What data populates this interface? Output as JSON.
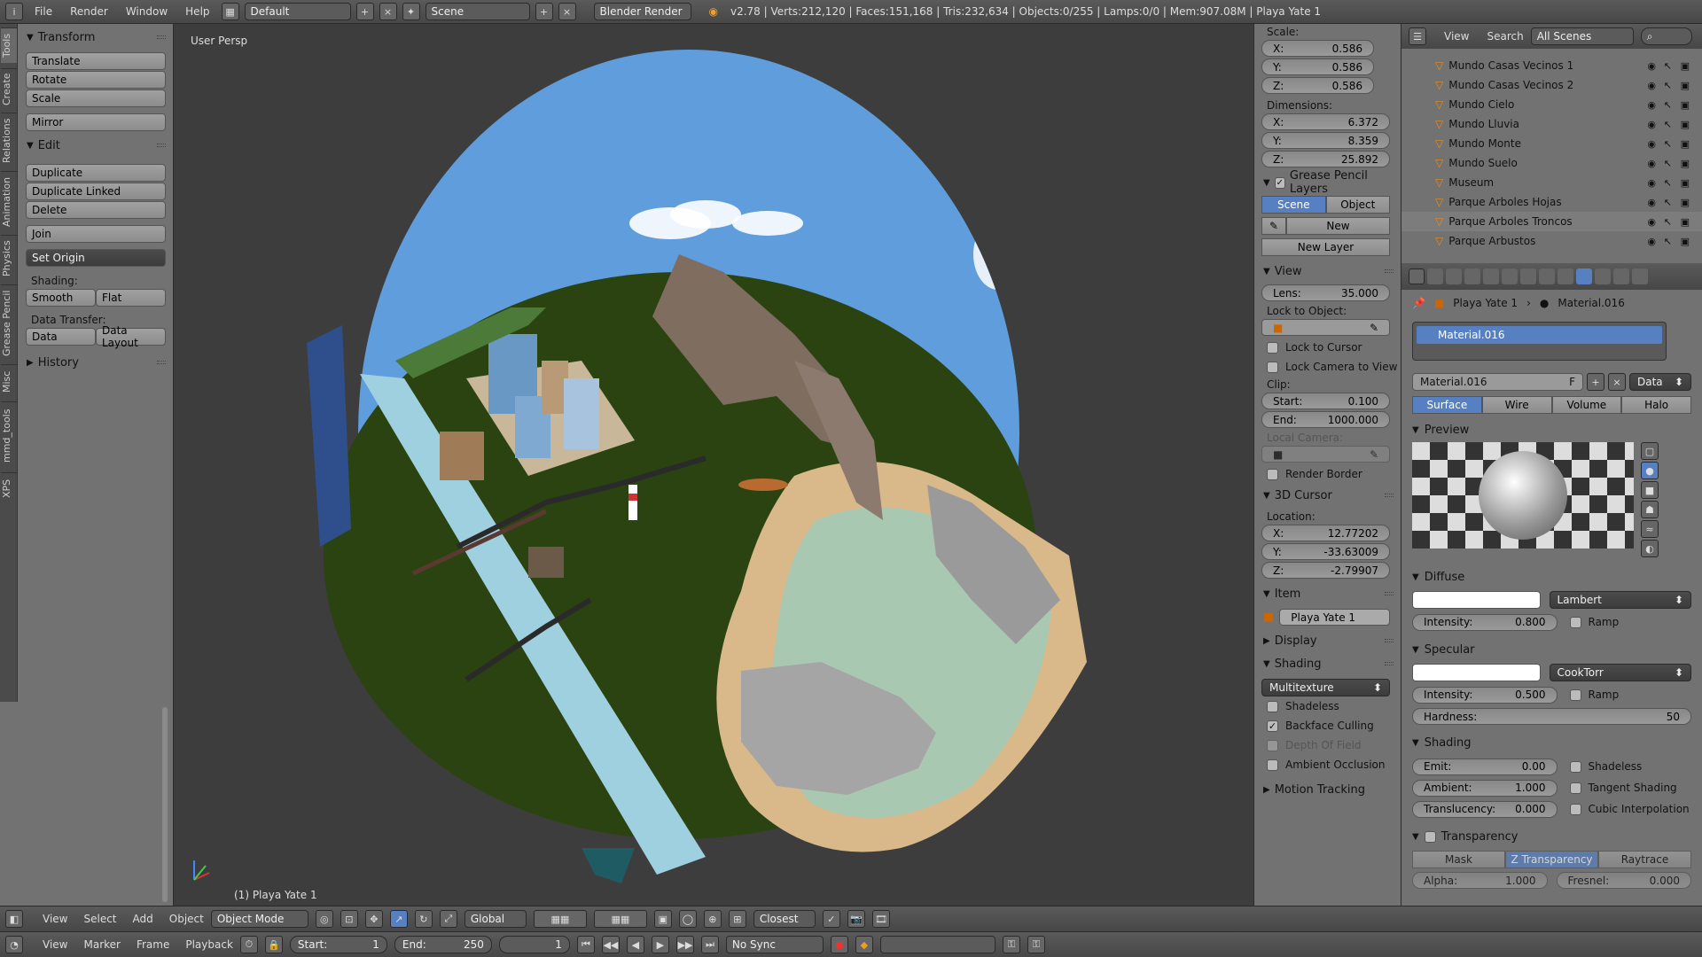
{
  "topbar": {
    "menus": [
      "File",
      "Render",
      "Window",
      "Help"
    ],
    "layout": "Default",
    "scene": "Scene",
    "engine": "Blender Render",
    "stats": "v2.78 | Verts:212,120 | Faces:151,168 | Tris:232,634 | Objects:0/255 | Lamps:0/0 | Mem:907.08M | Playa Yate 1"
  },
  "side_tabs": [
    "Tools",
    "Create",
    "Relations",
    "Animation",
    "Physics",
    "Grease Pencil",
    "Misc",
    "mmd_tools",
    "XPS"
  ],
  "toolshelf": {
    "transform_title": "Transform",
    "transform_buttons": [
      "Translate",
      "Rotate",
      "Scale"
    ],
    "mirror": "Mirror",
    "edit_title": "Edit",
    "edit_buttons": [
      "Duplicate",
      "Duplicate Linked",
      "Delete"
    ],
    "join": "Join",
    "set_origin": "Set Origin",
    "shading_label": "Shading:",
    "smooth": "Smooth",
    "flat": "Flat",
    "data_transfer_label": "Data Transfer:",
    "data": "Data",
    "data_layout": "Data Layout",
    "history": "History"
  },
  "viewport": {
    "persp_label": "User Persp",
    "object_label": "(1) Playa Yate 1"
  },
  "npanel": {
    "scale_label": "Scale:",
    "scale": [
      {
        "axis": "X:",
        "value": "0.586"
      },
      {
        "axis": "Y:",
        "value": "0.586"
      },
      {
        "axis": "Z:",
        "value": "0.586"
      }
    ],
    "dimensions_label": "Dimensions:",
    "dimensions": [
      {
        "axis": "X:",
        "value": "6.372"
      },
      {
        "axis": "Y:",
        "value": "8.359"
      },
      {
        "axis": "Z:",
        "value": "25.892"
      }
    ],
    "grease_title": "Grease Pencil Layers",
    "grease_scene": "Scene",
    "grease_object": "Object",
    "grease_new": "New",
    "grease_new_layer": "New Layer",
    "view_title": "View",
    "lens_label": "Lens:",
    "lens_value": "35.000",
    "lock_to_object": "Lock to Object:",
    "lock_to_cursor": "Lock to Cursor",
    "lock_camera": "Lock Camera to View",
    "clip_label": "Clip:",
    "clip_start_label": "Start:",
    "clip_start": "0.100",
    "clip_end_label": "End:",
    "clip_end": "1000.000",
    "local_camera": "Local Camera:",
    "render_border": "Render Border",
    "cursor_title": "3D Cursor",
    "location_label": "Location:",
    "cursor": [
      {
        "axis": "X:",
        "value": "12.77202"
      },
      {
        "axis": "Y:",
        "value": "-33.63009"
      },
      {
        "axis": "Z:",
        "value": "-2.79907"
      }
    ],
    "item_title": "Item",
    "item_name": "Playa Yate 1",
    "display_title": "Display",
    "shading_title": "Shading",
    "shading_mode": "Multitexture",
    "shadeless": "Shadeless",
    "backface": "Backface Culling",
    "depth_of_field": "Depth Of Field",
    "ambient_occlusion": "Ambient Occlusion",
    "motion_tracking": "Motion Tracking"
  },
  "outliner": {
    "view": "View",
    "search": "Search",
    "scenes": "All Scenes",
    "rows": [
      "Mundo Casas Vecinos 1",
      "Mundo Casas Vecinos 2",
      "Mundo Cielo",
      "Mundo Lluvia",
      "Mundo Monte",
      "Mundo Suelo",
      "Museum",
      "Parque Arboles Hojas",
      "Parque Arboles Troncos",
      "Parque Arbustos"
    ]
  },
  "material": {
    "breadcrumb_object": "Playa Yate 1",
    "breadcrumb_material": "Material.016",
    "slot_name": "Material.016",
    "datablock": "Material.016",
    "fake_user": "F",
    "link": "Data",
    "tabs": [
      "Surface",
      "Wire",
      "Volume",
      "Halo"
    ],
    "preview_title": "Preview",
    "diffuse_title": "Diffuse",
    "diffuse_shader": "Lambert",
    "diffuse_intensity_label": "Intensity:",
    "diffuse_intensity": "0.800",
    "ramp": "Ramp",
    "specular_title": "Specular",
    "specular_shader": "CookTorr",
    "specular_intensity_label": "Intensity:",
    "specular_intensity": "0.500",
    "hardness_label": "Hardness:",
    "hardness": "50",
    "shading_title": "Shading",
    "emit_label": "Emit:",
    "emit": "0.00",
    "ambient_label": "Ambient:",
    "ambient": "1.000",
    "translucency_label": "Translucency:",
    "translucency": "0.000",
    "shadeless": "Shadeless",
    "tangent": "Tangent Shading",
    "cubic": "Cubic Interpolation",
    "transparency_title": "Transparency",
    "trans_tabs": [
      "Mask",
      "Z Transparency",
      "Raytrace"
    ],
    "alpha_label": "Alpha:",
    "alpha": "1.000",
    "fresnel_label": "Fresnel:",
    "fresnel": "0.000"
  },
  "header3d": {
    "menus": [
      "View",
      "Select",
      "Add",
      "Object"
    ],
    "mode": "Object Mode",
    "orientation": "Global",
    "snap": "Closest"
  },
  "timeline": {
    "menus": [
      "View",
      "Marker",
      "Frame",
      "Playback"
    ],
    "start_label": "Start:",
    "start": "1",
    "end_label": "End:",
    "end": "250",
    "current": "1",
    "sync": "No Sync"
  }
}
